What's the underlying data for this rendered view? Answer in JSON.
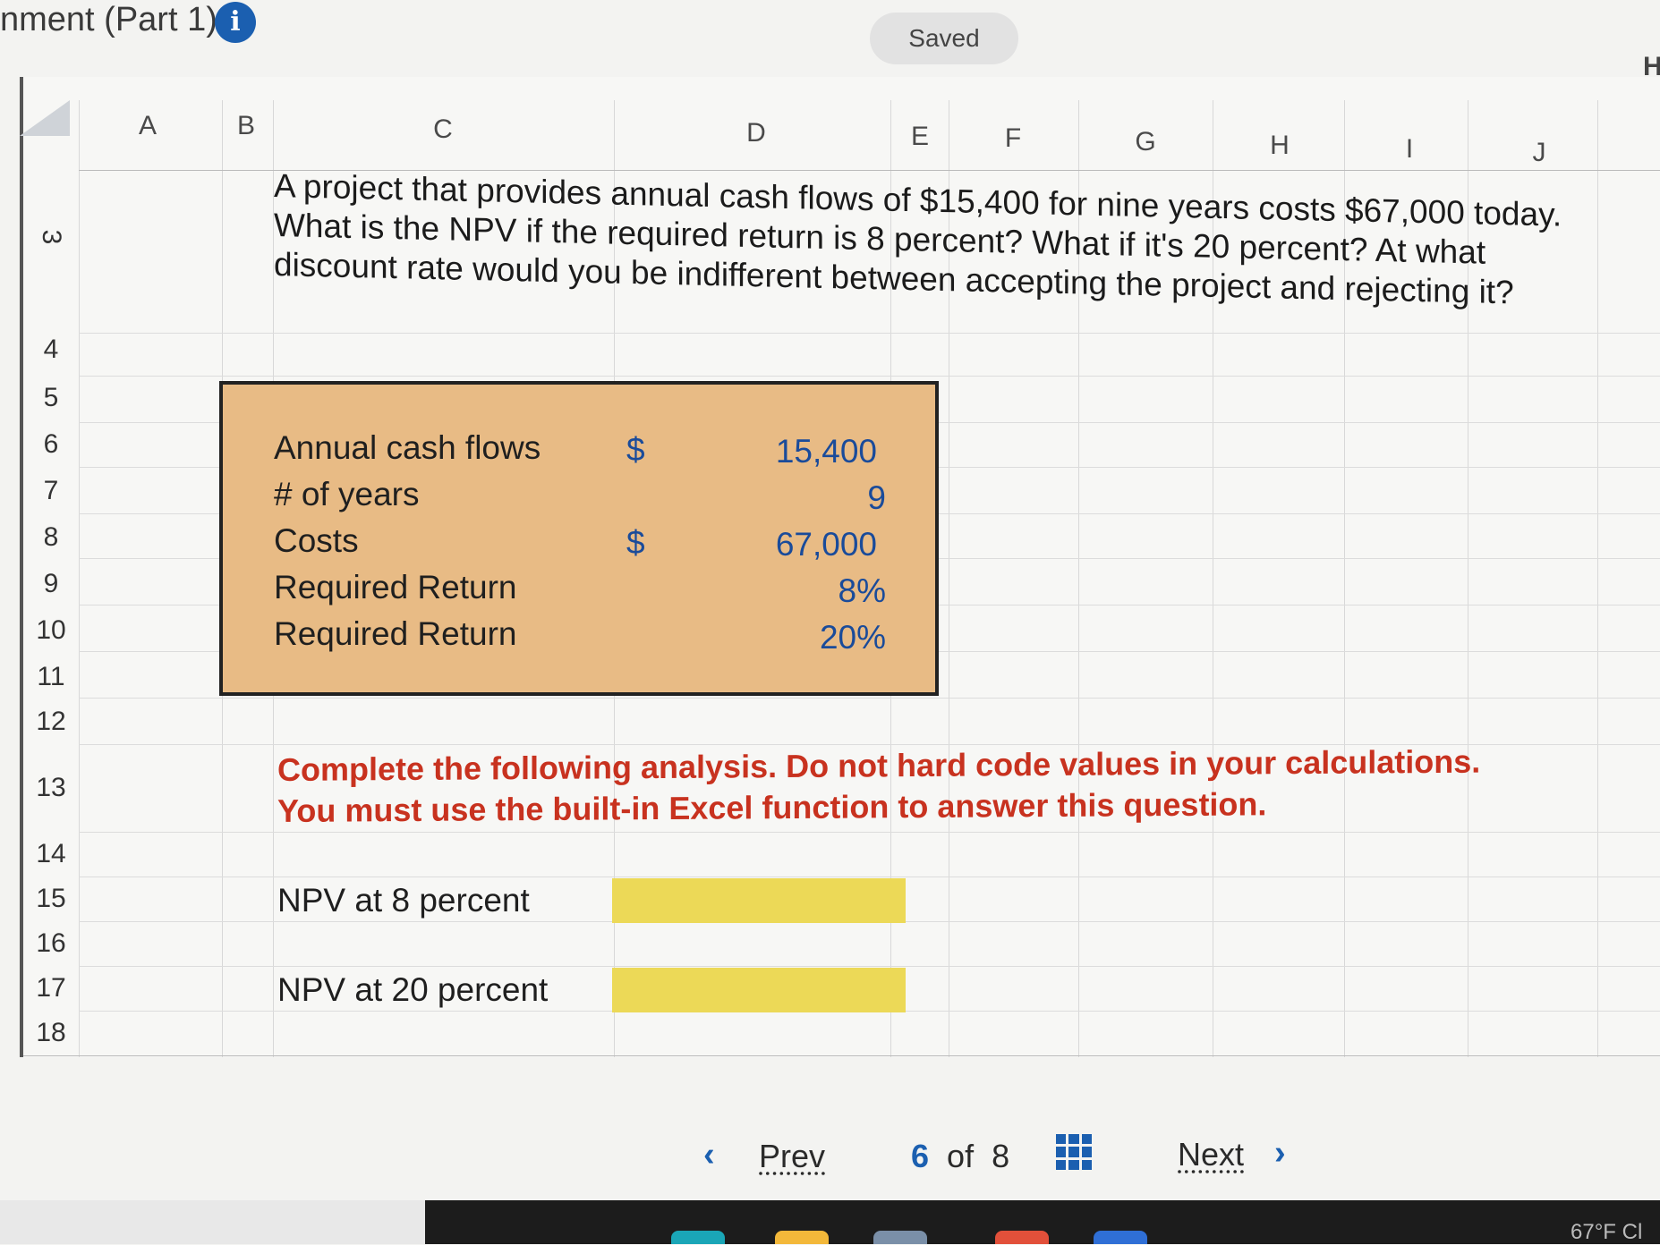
{
  "header": {
    "title": "nment (Part 1)",
    "info_icon": "info-icon",
    "saved_label": "Saved",
    "edge_letter": "H"
  },
  "sheet": {
    "columns": [
      "A",
      "B",
      "C",
      "D",
      "E",
      "F",
      "G",
      "H",
      "I",
      "J"
    ],
    "rows": [
      "3",
      "4",
      "5",
      "6",
      "7",
      "8",
      "9",
      "10",
      "11",
      "12",
      "13",
      "14",
      "15",
      "16",
      "17",
      "18"
    ],
    "question": "A project that provides annual cash flows of $15,400 for nine years costs $67,000 today. What is the NPV if the required return is 8 percent? What if it's 20 percent? At what discount rate would you be indifferent between accepting the project and rejecting it?",
    "inputs": [
      {
        "label": "Annual cash flows",
        "currency": "$",
        "value": "15,400"
      },
      {
        "label": "# of years",
        "currency": "",
        "value": "9"
      },
      {
        "label": "Costs",
        "currency": "$",
        "value": "67,000"
      },
      {
        "label": "Required Return",
        "currency": "",
        "value": "8%"
      },
      {
        "label": "Required Return",
        "currency": "",
        "value": "20%"
      }
    ],
    "instruction_line1": "Complete the following analysis. Do not hard code values in your calculations.",
    "instruction_line2": "You must use the built-in Excel function to answer this question.",
    "answers": [
      {
        "label": "NPV at 8 percent",
        "value": ""
      },
      {
        "label": "NPV at 20 percent",
        "value": ""
      }
    ],
    "colors": {
      "input_box": "#e8bb85",
      "answer_cell": "#ecd957",
      "instruction": "#c8321f",
      "value_text": "#1a4b9a"
    }
  },
  "nav": {
    "prev_label": "Prev",
    "page_current": "6",
    "page_of": "of",
    "page_total": "8",
    "grid_icon": "grid-icon",
    "next_label": "Next",
    "prev_icon": "chevron-left-icon",
    "next_icon": "chevron-right-icon"
  },
  "taskbar": {
    "weather": "67°F Cl"
  }
}
